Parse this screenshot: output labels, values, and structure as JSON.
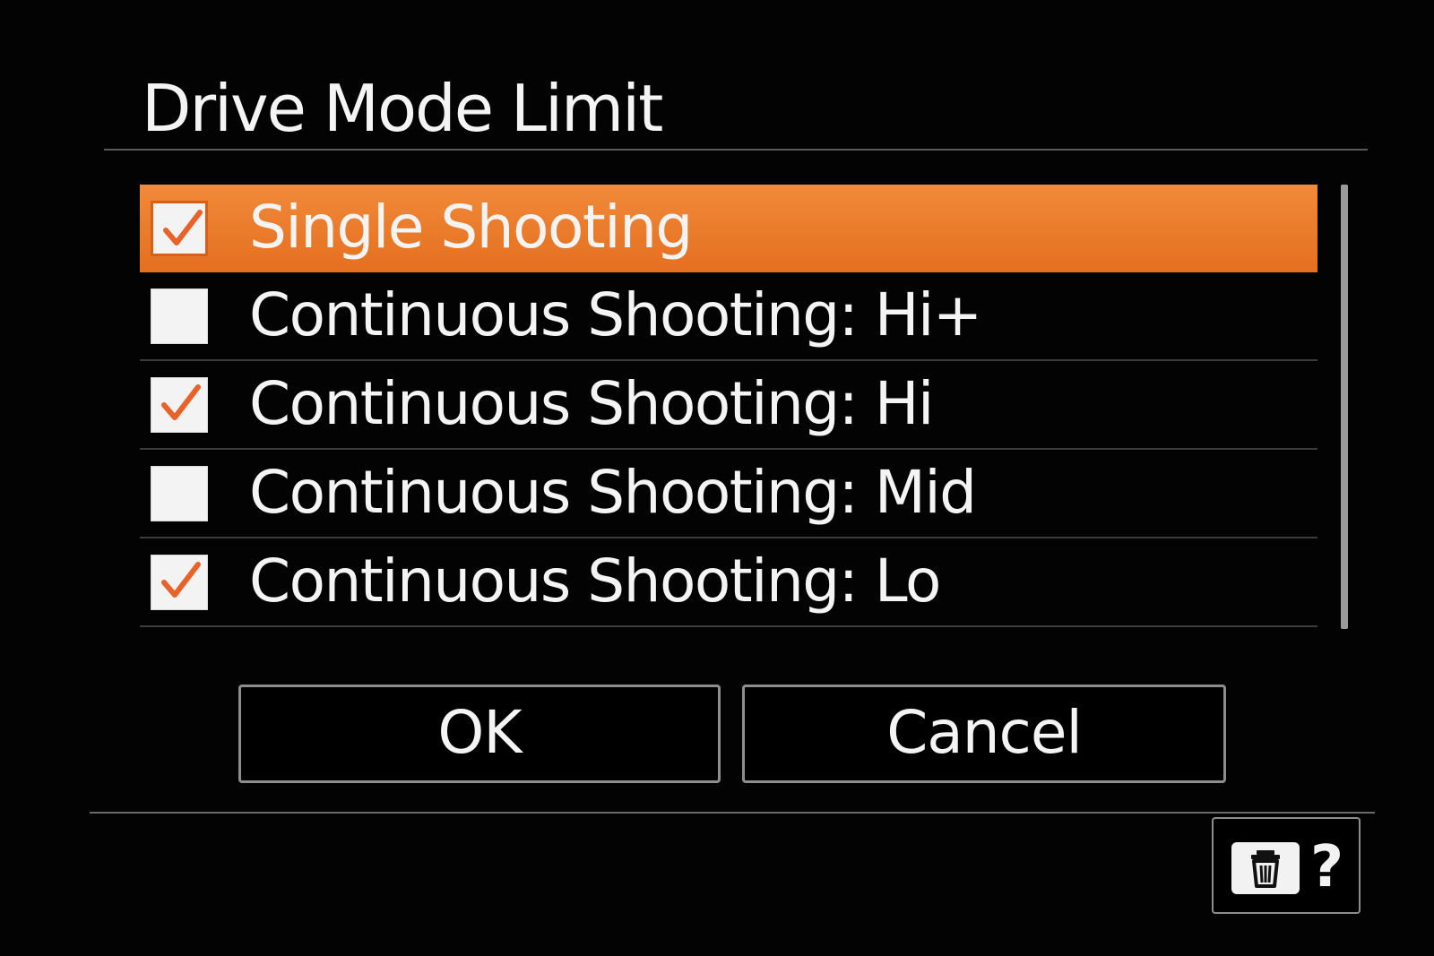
{
  "title": "Drive Mode Limit",
  "items": [
    {
      "label": "Single Shooting",
      "checked": true,
      "selected": true
    },
    {
      "label": "Continuous Shooting: Hi+",
      "checked": false,
      "selected": false
    },
    {
      "label": "Continuous Shooting: Hi",
      "checked": true,
      "selected": false
    },
    {
      "label": "Continuous Shooting: Mid",
      "checked": false,
      "selected": false
    },
    {
      "label": "Continuous Shooting: Lo",
      "checked": true,
      "selected": false
    }
  ],
  "buttons": {
    "ok": "OK",
    "cancel": "Cancel"
  },
  "help": {
    "question": "?",
    "delete_icon": "trash-icon"
  },
  "colors": {
    "accent": "#e97a2b",
    "check": "#e8632a"
  }
}
